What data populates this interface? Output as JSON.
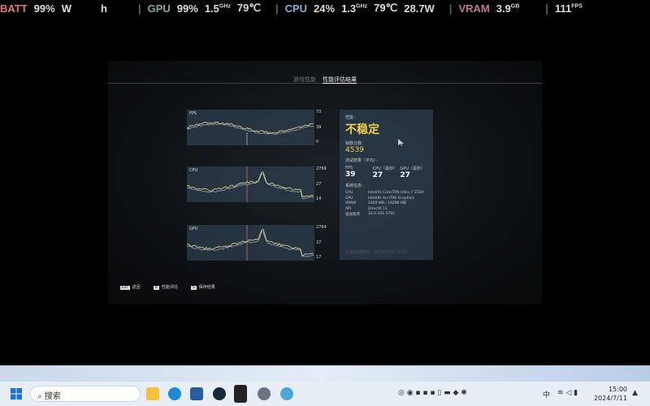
{
  "osd": {
    "batt_label": "BATT",
    "batt_val": "99%",
    "batt_w": "W",
    "batt_h": "h",
    "gpu_label": "GPU",
    "gpu_load": "99%",
    "gpu_clock": "1.5",
    "ghz": "GHz",
    "gpu_temp": "79℃",
    "cpu_label": "CPU",
    "cpu_load": "24%",
    "cpu_clock": "1.3",
    "cpu_temp": "79℃",
    "cpu_power": "28.7W",
    "vram_label": "VRAM",
    "vram_val": "3.9",
    "gb": "GB",
    "fps_val": "111",
    "fps_unit": "FPS",
    "colors": {
      "batt": "#e07a6a",
      "gpu": "#7fae8f",
      "cpu": "#7fb3d9",
      "vram": "#c07a8a"
    }
  },
  "tabs": [
    {
      "label": "游戏性能",
      "active": false
    },
    {
      "label": "性能评估结果",
      "active": true
    }
  ],
  "charts": [
    {
      "label": "FPS",
      "ticks": [
        "73",
        "39",
        "0"
      ]
    },
    {
      "label": "CPU",
      "ticks": [
        "2769",
        "27",
        "14"
      ]
    },
    {
      "label": "GPU",
      "ticks": [
        "2764",
        "27",
        "17"
      ]
    }
  ],
  "result": {
    "perf_label": "性能：",
    "perf_value": "不稳定",
    "score_label": "帧数分数：",
    "score": "4539",
    "avg_label": "测试结果（平均）：",
    "avg": [
      {
        "label": "FPS",
        "value": "39"
      },
      {
        "label": "CPU（毫秒）",
        "value": "27"
      },
      {
        "label": "GPU（毫秒）",
        "value": "27"
      }
    ],
    "sys_label": "系统信息：",
    "sys": [
      {
        "k": "CPU",
        "v": "Intel(R) Core(TM) Ultra 7 155H"
      },
      {
        "k": "GPU",
        "v": "Intel(R) Arc(TM) Graphics"
      },
      {
        "k": "VRAM",
        "v": "1920 MB / 16286 MB"
      },
      {
        "k": "API",
        "v": "DirectX 11"
      },
      {
        "k": "驱动程序",
        "v": "32.0.101.5762"
      }
    ],
    "footer": "测试完成时间：2024/7/11 15:00",
    "accent": "#f0d14a"
  },
  "keys": [
    {
      "key": "Esc",
      "label": "返回"
    },
    {
      "key": "R",
      "label": "性能评估"
    },
    {
      "key": "S",
      "label": "保存结果"
    }
  ],
  "taskbar": {
    "search_placeholder": "搜索",
    "ime": "中",
    "time": "15:00",
    "date": "2024/7/11"
  }
}
